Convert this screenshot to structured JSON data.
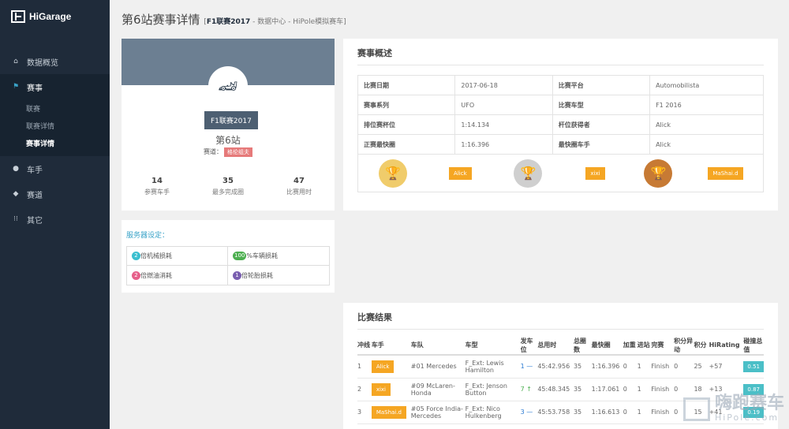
{
  "brand": {
    "name": "HiGarage"
  },
  "nav": {
    "dashboard": "数据概览",
    "events": "赛事",
    "sub": [
      "联赛",
      "联赛详情",
      "赛事详情"
    ],
    "drivers": "车手",
    "tracks": "赛道",
    "others": "其它"
  },
  "page": {
    "title": "第6站赛事详情",
    "league": "F1联赛2017",
    "sub_rest": " - 数据中心 - HiPole模拟赛车]"
  },
  "profile": {
    "badge": "F1联赛2017",
    "station": "第6站",
    "track_label": "赛道：",
    "track_name": "格伦组夫",
    "stats": [
      {
        "value": "14",
        "label": "参赛车手"
      },
      {
        "value": "35",
        "label": "最多完成圈"
      },
      {
        "value": "47",
        "label": "比赛用时"
      }
    ]
  },
  "server": {
    "title": "服务器设定：",
    "items": [
      {
        "num": "2",
        "text": "倍机械损耗",
        "color": "#3bbfcf"
      },
      {
        "num": "100",
        "text": "%车辆损耗",
        "color": "#4caf50"
      },
      {
        "num": "2",
        "text": "倍燃油消耗",
        "color": "#e6608a"
      },
      {
        "num": "1",
        "text": "倍轮胎损耗",
        "color": "#7a5fb0"
      }
    ]
  },
  "overview": {
    "title": "赛事概述",
    "rows": [
      [
        "比赛日期",
        "2017-06-18",
        "比赛平台",
        "Automobilista"
      ],
      [
        "赛事系列",
        "UFO",
        "比赛车型",
        "F1 2016"
      ],
      [
        "排位赛杯位",
        "1:14.134",
        "杆位获得者",
        "Alick"
      ],
      [
        "正赛最快圈",
        "1:16.396",
        "最快圈车手",
        "Alick"
      ]
    ],
    "podium": [
      {
        "driver": "Alick",
        "color": "#f0cc6b"
      },
      {
        "driver": "xixi",
        "color": "#cfcfcf"
      },
      {
        "driver": "MaShai.d",
        "color": "#c77a34"
      }
    ]
  },
  "results": {
    "title": "比赛结果",
    "headers": [
      "冲线",
      "车手",
      "车队",
      "车型",
      "发车位",
      "总用时",
      "总圈数",
      "最快圈",
      "加重",
      "进站",
      "完赛",
      "积分异动",
      "积分",
      "HiRating",
      "碰撞总值"
    ],
    "rows": [
      {
        "pos": "1",
        "driver": "Alick",
        "team": "#01 Mercedes",
        "car": "F_Ext: Lewis Hamilton",
        "grid": "1",
        "grid_arrow": "—",
        "time": "45:42.956",
        "laps": "35",
        "fastest": "1:16.396",
        "ballast": "0",
        "pit": "1",
        "finish": "Finish",
        "change": "0",
        "points": "25",
        "rating": "+57",
        "incident": "0.51"
      },
      {
        "pos": "2",
        "driver": "xixi",
        "team": "#09 McLaren-Honda",
        "car": "F_Ext: Jenson Button",
        "grid": "7",
        "grid_arrow": "↑",
        "time": "45:48.345",
        "laps": "35",
        "fastest": "1:17.061",
        "ballast": "0",
        "pit": "1",
        "finish": "Finish",
        "change": "0",
        "points": "18",
        "rating": "+13",
        "incident": "0.87"
      },
      {
        "pos": "3",
        "driver": "MaShai.d",
        "team": "#05 Force India-Mercedes",
        "car": "F_Ext: Nico Hulkenberg",
        "grid": "3",
        "grid_arrow": "—",
        "time": "45:53.758",
        "laps": "35",
        "fastest": "1:16.613",
        "ballast": "0",
        "pit": "1",
        "finish": "Finish",
        "change": "0",
        "points": "15",
        "rating": "+41",
        "incident": "0.19"
      }
    ]
  },
  "watermark": {
    "cn": "嗨跑赛车",
    "en": "HiPole.com"
  }
}
